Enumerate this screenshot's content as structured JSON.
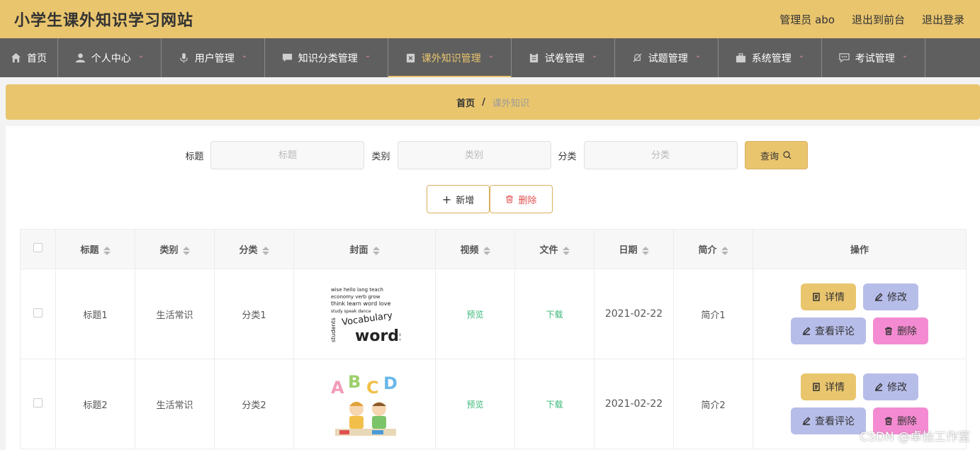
{
  "header": {
    "title": "小学生课外知识学习网站",
    "admin": "管理员 abo",
    "to_front": "退出到前台",
    "logout": "退出登录"
  },
  "nav": [
    {
      "label": "首页",
      "icon": "home-icon",
      "dropdown": false,
      "active": false
    },
    {
      "label": "个人中心",
      "icon": "user-icon",
      "dropdown": true,
      "active": false
    },
    {
      "label": "用户管理",
      "icon": "microphone-icon",
      "dropdown": true,
      "active": false
    },
    {
      "label": "知识分类管理",
      "icon": "chat-icon",
      "dropdown": true,
      "active": false
    },
    {
      "label": "课外知识管理",
      "icon": "clipboard-x-icon",
      "dropdown": true,
      "active": true
    },
    {
      "label": "试卷管理",
      "icon": "clipboard-icon",
      "dropdown": true,
      "active": false
    },
    {
      "label": "试题管理",
      "icon": "bell-off-icon",
      "dropdown": true,
      "active": false
    },
    {
      "label": "系统管理",
      "icon": "briefcase-icon",
      "dropdown": true,
      "active": false
    },
    {
      "label": "考试管理",
      "icon": "message-icon",
      "dropdown": true,
      "active": false
    }
  ],
  "breadcrumb": {
    "home": "首页",
    "separator": "/",
    "current": "课外知识"
  },
  "search": {
    "title_label": "标题",
    "title_placeholder": "标题",
    "category_label": "类别",
    "category_placeholder": "类别",
    "class_label": "分类",
    "class_placeholder": "分类",
    "query_label": "查询"
  },
  "actions": {
    "add": "新增",
    "delete": "删除"
  },
  "table": {
    "headers": [
      "标题",
      "类别",
      "分类",
      "封面",
      "视频",
      "文件",
      "日期",
      "简介",
      "操作"
    ],
    "rows": [
      {
        "title": "标题1",
        "category": "生活常识",
        "class": "分类1",
        "cover": "vocabulary-words-image",
        "video": "预览",
        "file": "下载",
        "date": "2021-02-22",
        "intro": "简介1"
      },
      {
        "title": "标题2",
        "category": "生活常识",
        "class": "分类2",
        "cover": "abcd-kids-image",
        "video": "预览",
        "file": "下载",
        "date": "2021-02-22",
        "intro": "简介2"
      }
    ],
    "ops": {
      "detail": "详情",
      "edit": "修改",
      "comments": "查看评论",
      "delete": "删除"
    }
  },
  "cover_text": {
    "vocabulary": "Vocabulary",
    "words": "words",
    "letters": [
      "A",
      "B",
      "C",
      "D"
    ]
  },
  "watermark": "CSDN @卓怡工作室",
  "colors": {
    "accent": "#e9c56e",
    "nav_bg": "#5f5f5f",
    "link": "#3cb879",
    "edit": "#b7bde9",
    "danger": "#f48bd2"
  }
}
